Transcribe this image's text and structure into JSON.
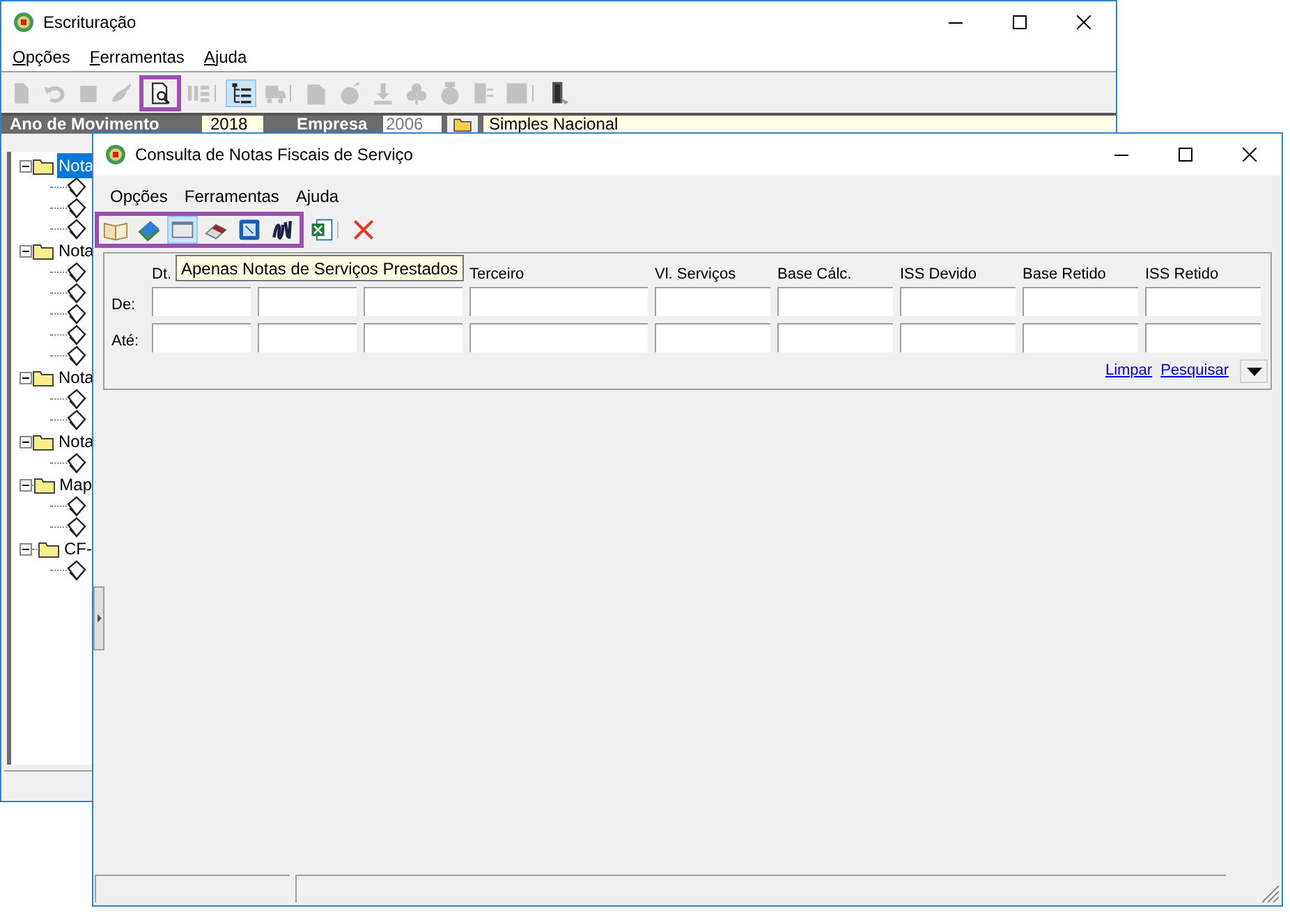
{
  "back_window": {
    "title": "Escrituração",
    "menu": {
      "mnemonics_shown": true,
      "items": [
        {
          "label": "Opções"
        },
        {
          "label": "Ferramentas"
        },
        {
          "label": "Ajuda"
        }
      ]
    },
    "toolbar": [
      {
        "highlighted": false,
        "separator_after": false,
        "items": [
          {
            "kind": "page",
            "disabled": true,
            "pressed": false
          },
          {
            "kind": "undo",
            "disabled": true,
            "pressed": false
          },
          {
            "kind": "stop",
            "disabled": true,
            "pressed": false
          },
          {
            "kind": "brush",
            "disabled": true,
            "pressed": false
          }
        ]
      },
      {
        "highlighted": true,
        "separator_after": false,
        "items": [
          {
            "kind": "preview",
            "disabled": false,
            "pressed": false
          }
        ]
      },
      {
        "highlighted": false,
        "separator_after": true,
        "items": [
          {
            "kind": "stripes",
            "disabled": true,
            "pressed": false
          }
        ]
      },
      {
        "highlighted": false,
        "separator_after": true,
        "items": [
          {
            "kind": "tree",
            "disabled": false,
            "pressed": true
          },
          {
            "kind": "truck",
            "disabled": true,
            "pressed": false
          }
        ]
      },
      {
        "highlighted": false,
        "separator_after": true,
        "items": [
          {
            "kind": "folder",
            "disabled": true,
            "pressed": false
          },
          {
            "kind": "apple",
            "disabled": true,
            "pressed": false
          },
          {
            "kind": "download",
            "disabled": true,
            "pressed": false
          },
          {
            "kind": "clover",
            "disabled": true,
            "pressed": false
          },
          {
            "kind": "coin",
            "disabled": true,
            "pressed": false
          },
          {
            "kind": "panel",
            "disabled": true,
            "pressed": false
          },
          {
            "kind": "square",
            "disabled": true,
            "pressed": false
          }
        ]
      },
      {
        "highlighted": false,
        "separator_after": false,
        "items": [
          {
            "kind": "door",
            "disabled": false,
            "pressed": false
          }
        ]
      }
    ],
    "info_bar": {
      "year_label": "Ano de Movimento",
      "year": "2018",
      "company_label": "Empresa",
      "company_code": "2006",
      "regime": "Simples Nacional"
    },
    "tree": [
      {
        "label": "Nota",
        "selected": true,
        "expanded": true,
        "children": [
          {
            "kind": "document"
          },
          {
            "kind": "document"
          },
          {
            "kind": "document"
          }
        ]
      },
      {
        "label": "Nota",
        "selected": false,
        "expanded": true,
        "children": [
          {
            "kind": "document"
          },
          {
            "kind": "document"
          },
          {
            "kind": "document"
          },
          {
            "kind": "document"
          },
          {
            "kind": "document"
          }
        ]
      },
      {
        "label": "Nota",
        "selected": false,
        "expanded": true,
        "children": [
          {
            "kind": "document"
          },
          {
            "kind": "document"
          }
        ]
      },
      {
        "label": "Nota",
        "selected": false,
        "expanded": true,
        "children": [
          {
            "kind": "document"
          }
        ]
      },
      {
        "label": "Map",
        "selected": false,
        "expanded": true,
        "children": [
          {
            "kind": "document"
          },
          {
            "kind": "document"
          }
        ]
      },
      {
        "label": "CF-",
        "selected": false,
        "expanded": true,
        "children": [
          {
            "kind": "document"
          }
        ]
      }
    ]
  },
  "front_window": {
    "title": "Consulta de Notas Fiscais de Serviço",
    "menu": {
      "mnemonics_shown": false,
      "items": [
        {
          "label": "Opções"
        },
        {
          "label": "Ferramentas"
        },
        {
          "label": "Ajuda"
        }
      ]
    },
    "toolbar": [
      {
        "highlighted": true,
        "separator_after": false,
        "items": [
          {
            "kind": "open-book",
            "disabled": false,
            "pressed": false
          },
          {
            "kind": "blue-book",
            "disabled": false,
            "pressed": false
          },
          {
            "kind": "window",
            "disabled": false,
            "pressed": true
          },
          {
            "kind": "eraser",
            "disabled": false,
            "pressed": false
          },
          {
            "kind": "blue-square",
            "disabled": false,
            "pressed": false
          },
          {
            "kind": "scribble",
            "disabled": false,
            "pressed": false
          }
        ]
      },
      {
        "highlighted": false,
        "separator_after": true,
        "items": [
          {
            "kind": "spreadsheet",
            "disabled": false,
            "pressed": false
          }
        ]
      },
      {
        "highlighted": false,
        "separator_after": false,
        "items": [
          {
            "kind": "cross",
            "disabled": false,
            "pressed": false
          }
        ]
      }
    ],
    "filter": {
      "columns": [
        {
          "kind": "date",
          "header": "Dt."
        },
        {
          "kind": "date"
        },
        {
          "kind": "date"
        },
        {
          "kind": "wide",
          "header": "Terceiro"
        },
        {
          "kind": "value",
          "header": "Vl. Serviços"
        },
        {
          "kind": "value",
          "header": "Base Cálc."
        },
        {
          "kind": "value",
          "header": "ISS Devido"
        },
        {
          "kind": "value",
          "header": "Base Retido"
        },
        {
          "kind": "value",
          "header": "ISS Retido"
        }
      ],
      "rows": [
        {
          "label": "De:"
        },
        {
          "label": "Até:"
        }
      ],
      "links": [
        "Limpar",
        "Pesquisar"
      ]
    },
    "tooltip": "Apenas Notas de Serviços Prestados"
  }
}
